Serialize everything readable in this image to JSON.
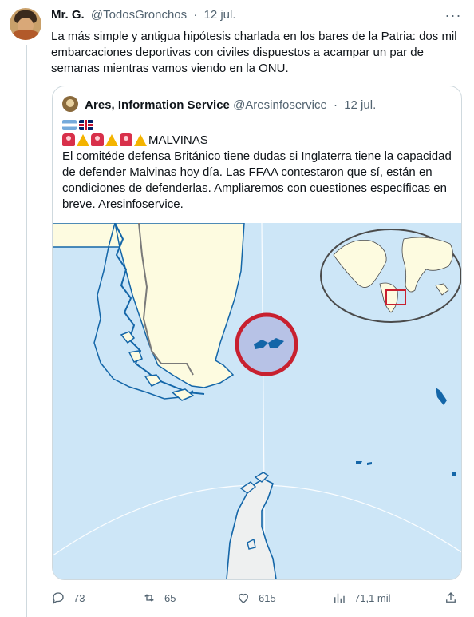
{
  "tweet": {
    "author_name": "Mr. G.",
    "author_handle": "@TodosGronchos",
    "separator": "·",
    "time": "12 jul.",
    "more_glyph": "···",
    "text": "La más simple y antigua hipótesis charlada en los bares de la Patria: dos mil embarcaciones deportivas con civiles dispuestos a acampar un par de semanas mientras vamos viendo en la ONU."
  },
  "quoted_tweet": {
    "author_name": "Ares, Information Service",
    "author_handle": "@Aresinfoservice",
    "separator": "·",
    "time": "12 jul.",
    "flags": [
      "argentina-flag",
      "uk-flag"
    ],
    "alert_emojis": [
      "siren",
      "warning",
      "siren",
      "warning",
      "siren",
      "warning"
    ],
    "alert_word": "MALVINAS",
    "text": "El comitéde defensa Británico tiene dudas si Inglaterra tiene la capacidad de defender Malvinas hoy día. Las FFAA contestaron que sí, están en condiciones de defenderlas. Ampliaremos con cuestiones específicas en breve. Aresinfoservice.",
    "media": "map-falkland-islands-south-atlantic"
  },
  "actions": {
    "replies": "73",
    "retweets": "65",
    "likes": "615",
    "views": "71,1 mil"
  },
  "colors": {
    "accent": "#1d9bf0",
    "text_primary": "#0f1419",
    "text_secondary": "#536471",
    "border": "#cfd9de",
    "map_sea": "#cde6f7",
    "map_land": "#fdfbe0",
    "map_highlight": "#c8202f"
  }
}
